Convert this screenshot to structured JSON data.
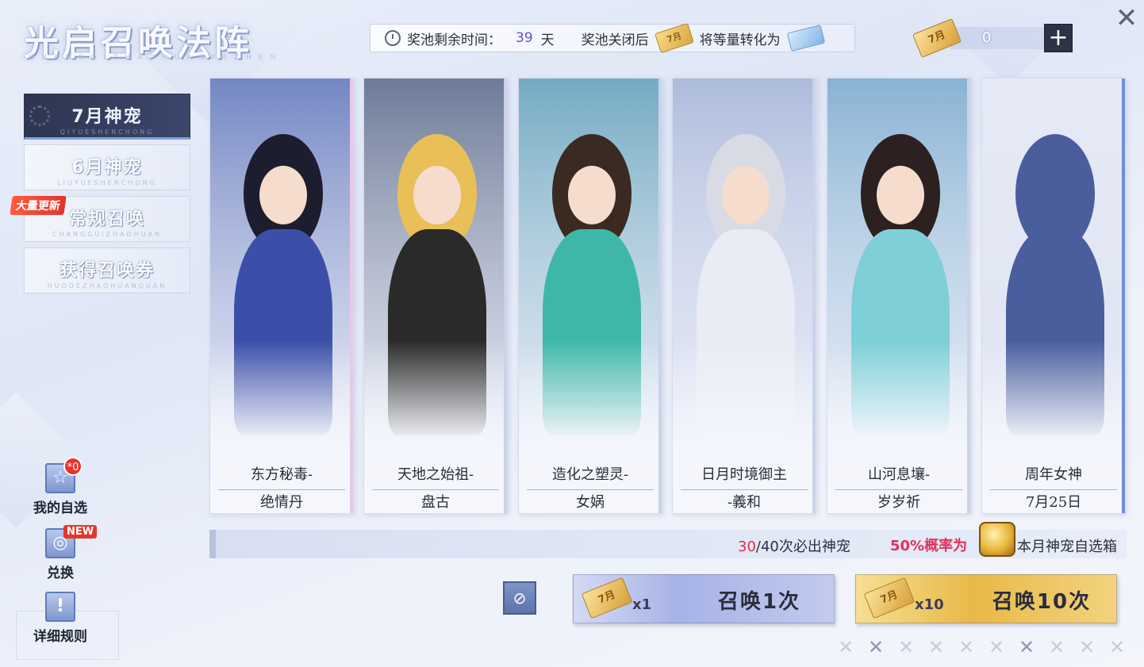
{
  "title": {
    "main": "光启召唤法阵",
    "sub": "GUANGQIZHAOHUANFAZHEN"
  },
  "info_bar": {
    "time_label": "奖池剩余时间：",
    "days_value": "39",
    "days_unit": "天",
    "after_close": "奖池关闭后",
    "ticket_label": "7月",
    "convert_text": "将等量转化为"
  },
  "currency": {
    "ticket_label": "7月",
    "amount": "0",
    "plus": "+"
  },
  "close_glyph": "✕",
  "tabs": [
    {
      "label": "7月神宠",
      "sub": "QIYUESHENCHONG",
      "active": true
    },
    {
      "label": "6月神宠",
      "sub": "LIUYUESHENCHONG",
      "active": false
    },
    {
      "label": "常规召唤",
      "sub": "CHANGGUIZHAOHUAN",
      "active": false
    },
    {
      "label": "获得召唤券",
      "sub": "HUODEZHAOHUANQUAN",
      "active": false
    }
  ],
  "update_badge": "大量更新",
  "side_buttons": {
    "my_pick": {
      "label": "我的自选",
      "badge": "*0",
      "icon": "star-icon"
    },
    "exchange": {
      "label": "兑换",
      "badge": "NEW",
      "icon": "swirl-icon"
    },
    "rules": {
      "label": "详细规则",
      "icon": "info-icon"
    }
  },
  "cards": [
    {
      "line1": "东方秘毒-",
      "line2": "绝情丹",
      "accent": "#3b4fa8",
      "hair": "#1c1d2e",
      "edge": "#e8c8e8"
    },
    {
      "line1": "天地之始祖-",
      "line2": "盘古",
      "accent": "#2a2a2a",
      "hair": "#e8c057",
      "edge": "#c9d3ea"
    },
    {
      "line1": "造化之塑灵-",
      "line2": "女娲",
      "accent": "#3fb7a8",
      "hair": "#3a2a22",
      "edge": "#c9d3ea"
    },
    {
      "line1": "日月时境御主",
      "line2": "-義和",
      "accent": "#e9ecf4",
      "hair": "#d9dbe4",
      "edge": "#c9d3ea"
    },
    {
      "line1": "山河息壤-",
      "line2": "岁岁祈",
      "accent": "#7ecfd8",
      "hair": "#2c2020",
      "edge": "#c9d3ea"
    },
    {
      "line1": "周年女神",
      "line2": "7月25日",
      "accent": "#4a5e9e",
      "hair": "#4a5e9e",
      "edge": "#6f8fd8"
    }
  ],
  "progress": {
    "current": "30",
    "rest": "/40次必出神宠",
    "rate_text": "50%概率为",
    "box_text": "本月神宠自选箱"
  },
  "summon": {
    "video_icon": "no-video-icon",
    "one": {
      "ticket": "7月",
      "mult": "x1",
      "label": "召唤1次"
    },
    "ten": {
      "ticket": "7月",
      "mult": "x10",
      "label": "召唤10次"
    }
  }
}
